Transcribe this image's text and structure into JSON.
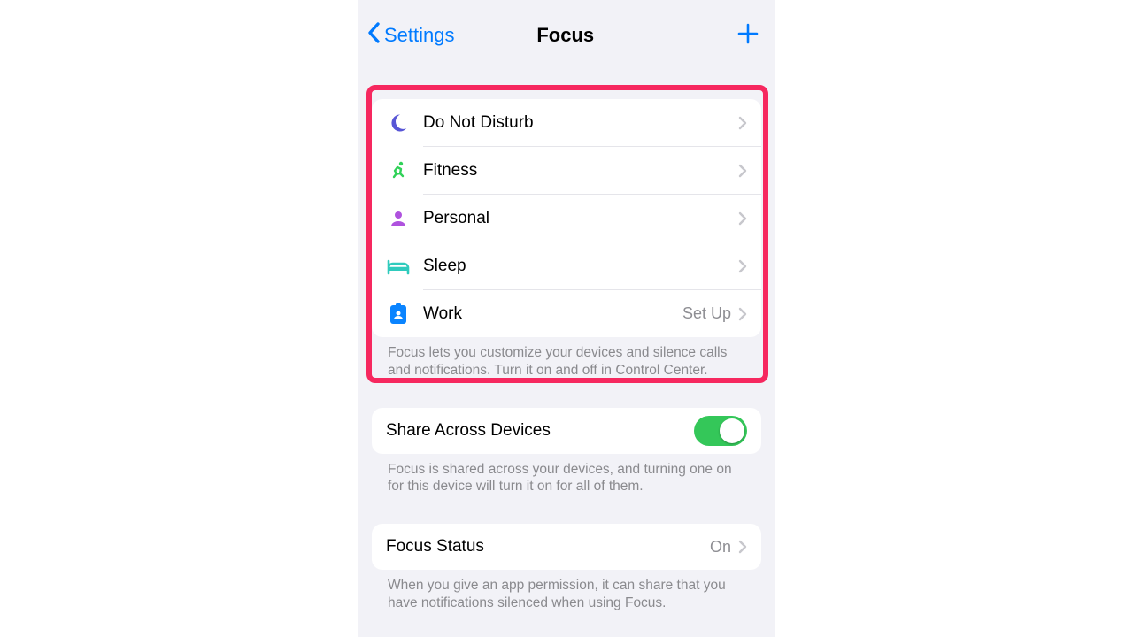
{
  "nav": {
    "back": "Settings",
    "title": "Focus"
  },
  "focus_modes": [
    {
      "label": "Do Not Disturb",
      "trailing": ""
    },
    {
      "label": "Fitness",
      "trailing": ""
    },
    {
      "label": "Personal",
      "trailing": ""
    },
    {
      "label": "Sleep",
      "trailing": ""
    },
    {
      "label": "Work",
      "trailing": "Set Up"
    }
  ],
  "modes_footer": "Focus lets you customize your devices and silence calls and notifications. Turn it on and off in Control Center.",
  "share": {
    "label": "Share Across Devices",
    "on": true
  },
  "share_footer": "Focus is shared across your devices, and turning one on for this device will turn it on for all of them.",
  "status": {
    "label": "Focus Status",
    "value": "On"
  },
  "status_footer": "When you give an app permission, it can share that you have notifications silenced when using Focus.",
  "colors": {
    "blue": "#007aff",
    "green": "#34c759",
    "purple": "#af52de",
    "indigo": "#5856d6",
    "teal": "#2fcbbd",
    "brightgreen": "#30d158",
    "badge_blue": "#0a84ff",
    "pink_highlight": "#f6285f"
  }
}
